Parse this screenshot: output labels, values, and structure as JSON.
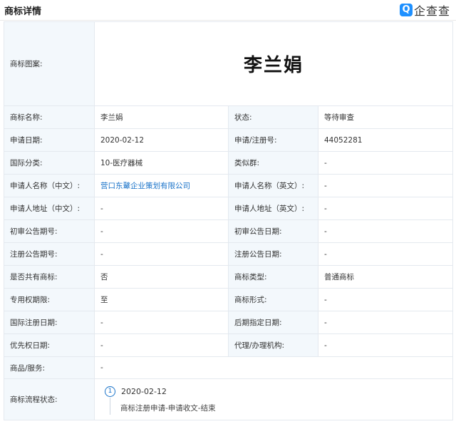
{
  "header": {
    "title": "商标详情",
    "brand": "企查查",
    "brand_logo": "Q"
  },
  "trademark": {
    "image_label": "商标图案:",
    "image_text": "李兰娟"
  },
  "rows": [
    {
      "l1": "商标名称:",
      "v1": "李兰娟",
      "l2": "状态:",
      "v2": "等待审查"
    },
    {
      "l1": "申请日期:",
      "v1": "2020-02-12",
      "l2": "申请/注册号:",
      "v2": "44052281"
    },
    {
      "l1": "国际分类:",
      "v1": "10-医疗器械",
      "l2": "类似群:",
      "v2": "-"
    },
    {
      "l1": "申请人名称（中文）:",
      "v1": "营口东鼙企业策划有限公司",
      "l2": "申请人名称（英文）:",
      "v2": "-"
    },
    {
      "l1": "申请人地址（中文）:",
      "v1": "-",
      "l2": "申请人地址（英文）:",
      "v2": "-"
    },
    {
      "l1": "初审公告期号:",
      "v1": "-",
      "l2": "初审公告日期:",
      "v2": "-"
    },
    {
      "l1": "注册公告期号:",
      "v1": "-",
      "l2": "注册公告日期:",
      "v2": "-"
    },
    {
      "l1": "是否共有商标:",
      "v1": "否",
      "l2": "商标类型:",
      "v2": "普通商标"
    },
    {
      "l1": "专用权期限:",
      "v1": "至",
      "l2": "商标形式:",
      "v2": "-"
    },
    {
      "l1": "国际注册日期:",
      "v1": "-",
      "l2": "后期指定日期:",
      "v2": "-"
    },
    {
      "l1": "优先权日期:",
      "v1": "-",
      "l2": "代理/办理机构:",
      "v2": "-"
    }
  ],
  "goods": {
    "label": "商品/服务:",
    "value": "-"
  },
  "flow": {
    "label": "商标流程状态:",
    "step_number": "1",
    "date": "2020-02-12",
    "description": "商标注册申请-申请收文-结束"
  },
  "colors": {
    "label_bg": "#f3f8fc",
    "border": "#e4e9ef",
    "link": "#1a73c9",
    "brand": "#1e90ff"
  }
}
